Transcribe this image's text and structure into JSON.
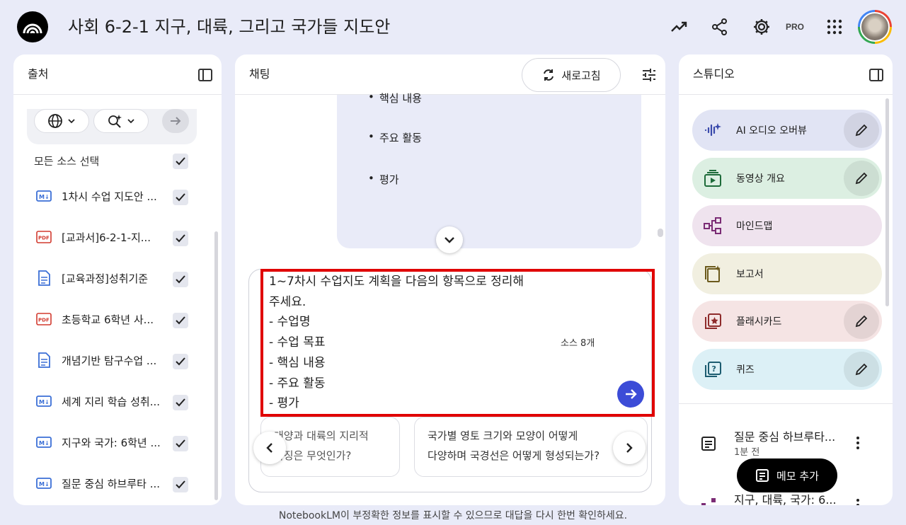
{
  "header": {
    "title": "사회 6-2-1 지구, 대륙, 그리고 국가들 지도안",
    "pro_label": "PRO",
    "icons": [
      "analytics-icon",
      "share-icon",
      "settings-icon",
      "apps-grid-icon"
    ]
  },
  "sources": {
    "title": "출처",
    "select_all_label": "모든 소스 선택",
    "items": [
      {
        "label": "1차시 수업 지도안 ...",
        "type": "md"
      },
      {
        "label": "[교과서]6-2-1-지...",
        "type": "pdf"
      },
      {
        "label": "[교육과정]성취기준",
        "type": "doc"
      },
      {
        "label": "초등학교 6학년 사...",
        "type": "pdf"
      },
      {
        "label": "개념기반 탐구수업 ...",
        "type": "doc"
      },
      {
        "label": "세계 지리 학습 성취...",
        "type": "md"
      },
      {
        "label": "지구와 국가: 6학년 ...",
        "type": "md"
      },
      {
        "label": "질문 중심 하브루타 ...",
        "type": "md"
      }
    ]
  },
  "chat": {
    "title": "채팅",
    "refresh_label": "새로고침",
    "bubble_items": [
      "핵심 내용",
      "주요 활동",
      "평가"
    ],
    "prompt": "1~7차시 수업지도 계획을 다음의 항목으로 정리해\n주세요.\n- 수업명\n- 수업 목표\n- 핵심 내용\n- 주요 활동\n- 평가",
    "source_count": "소스 8개",
    "suggestions": [
      "대양과 대륙의 지리적\n특징은 무엇인가?",
      "국가별 영토 크기와 모양이 어떻게\n다양하며 국경선은 어떻게 형성되는가?"
    ]
  },
  "studio": {
    "title": "스튜디오",
    "tiles": [
      {
        "label": "AI 오디오 오버뷰",
        "color": "#e1e4f4",
        "icon_color": "#3949ab"
      },
      {
        "label": "동영상 개요",
        "color": "#dcefe2",
        "icon_color": "#1e6b3a"
      },
      {
        "label": "마인드맵",
        "color": "#efe3ee",
        "icon_color": "#7b2c75"
      },
      {
        "label": "보고서",
        "color": "#f1efe0",
        "icon_color": "#6b5a1c"
      },
      {
        "label": "플래시카드",
        "color": "#f5e4e4",
        "icon_color": "#8e2b2b"
      },
      {
        "label": "퀴즈",
        "color": "#dcf0f6",
        "icon_color": "#1c5c70"
      }
    ],
    "notes": [
      {
        "title": "질문 중심 하브루타...",
        "time": "1분 전"
      },
      {
        "title": "지구, 대륙, 국가: 6...",
        "time": ""
      }
    ],
    "memo_label": "메모 추가"
  },
  "footer": "NotebookLM이 부정확한 정보를 표시할 수 있으므로 대답을 다시 한번 확인하세요."
}
